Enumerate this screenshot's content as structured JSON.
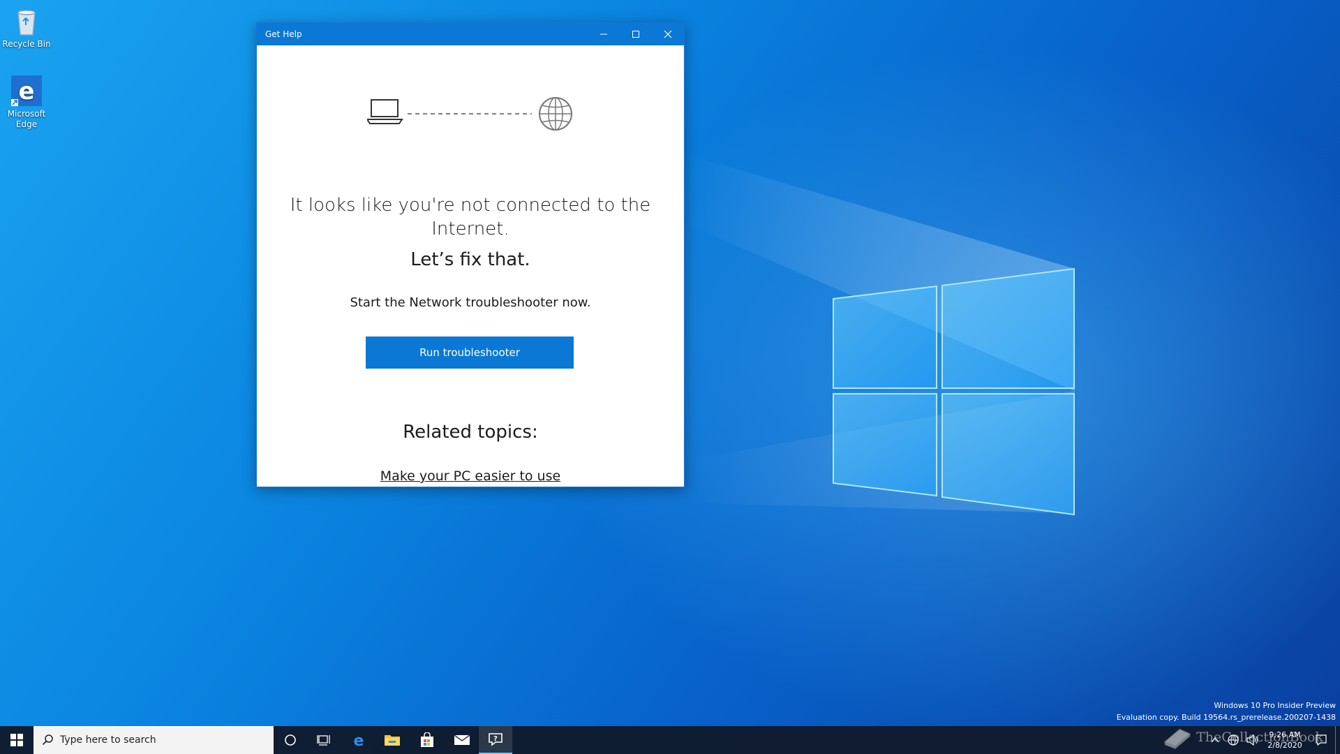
{
  "desktop": {
    "icons": [
      {
        "label": "Recycle Bin"
      },
      {
        "label": "Microsoft Edge"
      }
    ]
  },
  "window": {
    "title": "Get Help",
    "headline": "It looks like you're not connected to the Internet.",
    "subhead": "Let’s fix that.",
    "instruction": "Start the Network troubleshooter now.",
    "run_button_label": "Run troubleshooter",
    "related_title": "Related topics:",
    "related_link": "Make your PC easier to use"
  },
  "watermark": {
    "line1": "Windows 10 Pro Insider Preview",
    "line2": "Evaluation copy. Build 19564.rs_prerelease.200207-1438"
  },
  "taskbar": {
    "search_placeholder": "Type here to search",
    "pinned": [
      "cortana-icon",
      "task-view-icon",
      "edge-icon",
      "file-explorer-icon",
      "store-icon",
      "mail-icon",
      "get-help-icon"
    ],
    "active_app": "get-help-icon"
  },
  "tray": {
    "time": "9:26 AM",
    "date": "2/8/2020"
  },
  "overlay": {
    "brand_text": "TheCollectionBook"
  },
  "colors": {
    "accent": "#0a78d4",
    "taskbar": "#101a2c",
    "window_bg": "#ffffff"
  }
}
